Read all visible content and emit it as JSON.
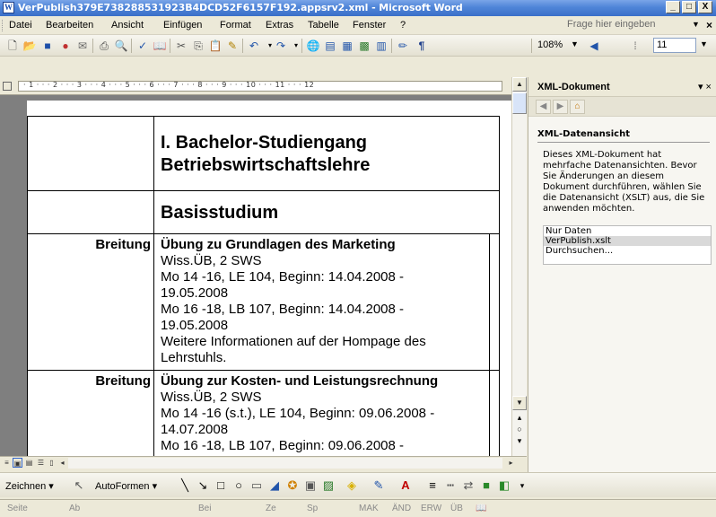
{
  "window": {
    "title": "VerPublish379E7382885319​23B4DCD52F6157F192.appsrv2.xml - Microsoft Word",
    "minimize": "_",
    "maximize": "□",
    "close": "X"
  },
  "menu": {
    "items": [
      "Datei",
      "Bearbeiten",
      "Ansicht",
      "Einfügen",
      "Format",
      "Extras",
      "Tabelle",
      "Fenster",
      "?"
    ],
    "help_placeholder": "Frage hier eingeben",
    "close_doc": "×"
  },
  "toolbar": {
    "zoom": "108%",
    "font_size": "11",
    "paragraph_mark": "¶"
  },
  "ruler": {
    "text": "· 1 · · · 2 · · · 3 · · · 4 · · · 5 · · · 6 · · · 7 · · · 8 · · · 9 · · · 10 · · · 11 · · · 12"
  },
  "document": {
    "heading1_line1": "I. Bachelor-Studiengang",
    "heading1_line2": "Betriebswirtschaftslehre",
    "heading2": "Basisstudium",
    "courses": [
      {
        "category": "Breitung",
        "title": "Übung zu Grundlagen des Marketing",
        "lines": [
          "Wiss.ÜB, 2 SWS",
          "Mo 14 -16, LE 104, Beginn: 14.04.2008 -",
          "19.05.2008",
          "Mo 16 -18, LB 107, Beginn: 14.04.2008 -",
          "19.05.2008",
          "Weitere Informationen auf der Hompage des",
          "Lehrstuhls."
        ]
      },
      {
        "category": "Breitung",
        "title": "Übung zur Kosten- und Leistungsrechnung",
        "lines": [
          "Wiss.ÜB, 2 SWS",
          "Mo 14 -16   (s.t.), LE 104, Beginn: 09.06.2008 -",
          "14.07.2008",
          "Mo 16 -18, LB 107, Beginn: 09.06.2008 -"
        ]
      }
    ]
  },
  "drawbar": {
    "draw_label": "Zeichnen ▾",
    "autoshapes_label": "AutoFormen ▾"
  },
  "status": {
    "items": [
      "Seite",
      "Ab",
      "Bei",
      "Ze",
      "Sp",
      "MAK",
      "ÄND",
      "ERW",
      "ÜB"
    ]
  },
  "taskpane": {
    "title": "XML-Dokument",
    "section": "XML-Datenansicht",
    "description": "Dieses XML-Dokument hat mehrfache Datenansichten. Bevor Sie Änderungen an diesem Dokument durchführen, wählen Sie die Datenansicht (XSLT) aus, die Sie anwenden möchten.",
    "options": [
      "Nur Daten",
      "VerPublish.xslt",
      "Durchsuchen..."
    ],
    "selected_index": 1
  }
}
